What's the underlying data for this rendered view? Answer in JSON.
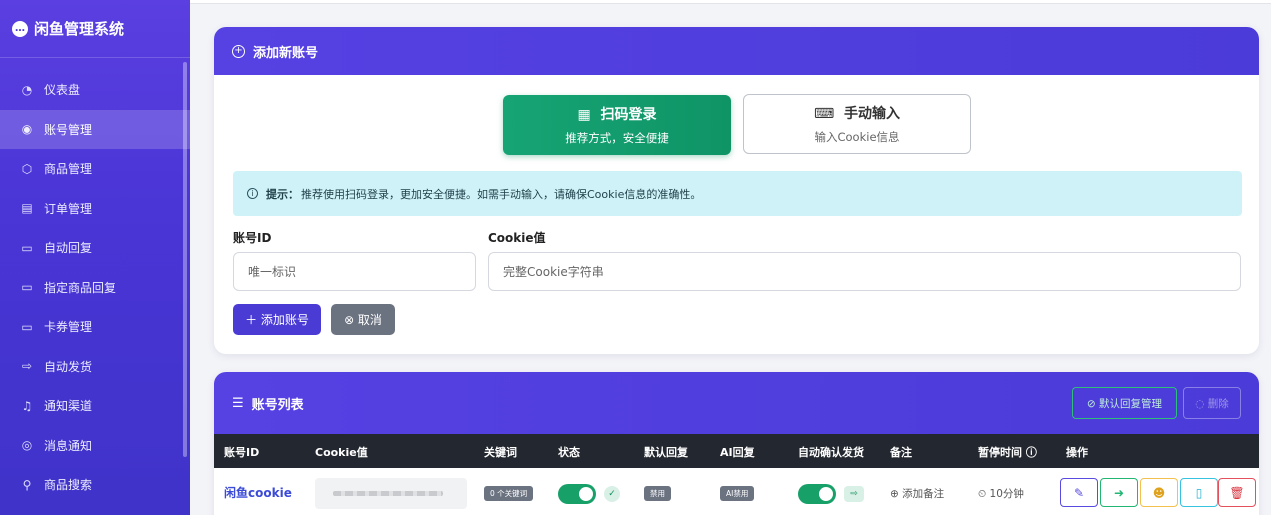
{
  "app": {
    "title": "闲鱼管理系统"
  },
  "sidebar": {
    "items": [
      {
        "label": "仪表盘",
        "icon": "dashboard-icon",
        "glyph": "◔"
      },
      {
        "label": "账号管理",
        "icon": "user-circle-icon",
        "glyph": "◉",
        "active": true
      },
      {
        "label": "商品管理",
        "icon": "box-icon",
        "glyph": "⬡"
      },
      {
        "label": "订单管理",
        "icon": "receipt-icon",
        "glyph": "▤"
      },
      {
        "label": "自动回复",
        "icon": "chat-square-icon",
        "glyph": "▭"
      },
      {
        "label": "指定商品回复",
        "icon": "chat-square-icon",
        "glyph": "▭"
      },
      {
        "label": "卡券管理",
        "icon": "card-icon",
        "glyph": "▭"
      },
      {
        "label": "自动发货",
        "icon": "truck-icon",
        "glyph": "⇨"
      },
      {
        "label": "通知渠道",
        "icon": "bell-icon",
        "glyph": "♫"
      },
      {
        "label": "消息通知",
        "icon": "chat-dots-icon",
        "glyph": "◎"
      },
      {
        "label": "商品搜索",
        "icon": "search-icon",
        "glyph": "⚲"
      }
    ]
  },
  "add_account": {
    "title": "添加新账号",
    "qr_login": {
      "title": "扫码登录",
      "subtitle": "推荐方式，安全便捷"
    },
    "manual_input": {
      "title": "手动输入",
      "subtitle": "输入Cookie信息"
    },
    "tip_label": "提示：",
    "tip_text": "推荐使用扫码登录，更加安全便捷。如需手动输入，请确保Cookie信息的准确性。",
    "account_id_label": "账号ID",
    "account_id_placeholder": "唯一标识",
    "cookie_label": "Cookie值",
    "cookie_placeholder": "完整Cookie字符串",
    "add_button": "＋ 添加账号",
    "cancel_button": "⊗ 取消"
  },
  "account_list": {
    "title": "账号列表",
    "default_reply_button": "⊘ 默认回复管理",
    "delete_button": "◌ 删除",
    "columns": [
      "账号ID",
      "Cookie值",
      "关键词",
      "状态",
      "默认回复",
      "AI回复",
      "自动确认发货",
      "备注",
      "暂停时间 ⓘ",
      "操作"
    ],
    "rows": [
      {
        "account_id": "闲鱼cookie",
        "keywords": "0 个关键词",
        "enabled": true,
        "default_reply": "禁用",
        "ai_reply": "AI禁用",
        "auto_confirm": true,
        "note": "⊕ 添加备注",
        "pause_time": "⏲ 10分钟"
      }
    ]
  },
  "colors": {
    "sidebar": "#4a35d6",
    "header": "#5641e3",
    "primary_button": "#4a3bd5",
    "success": "#18a069",
    "tip_bg": "#cff2f8",
    "table_head": "#23272f"
  }
}
